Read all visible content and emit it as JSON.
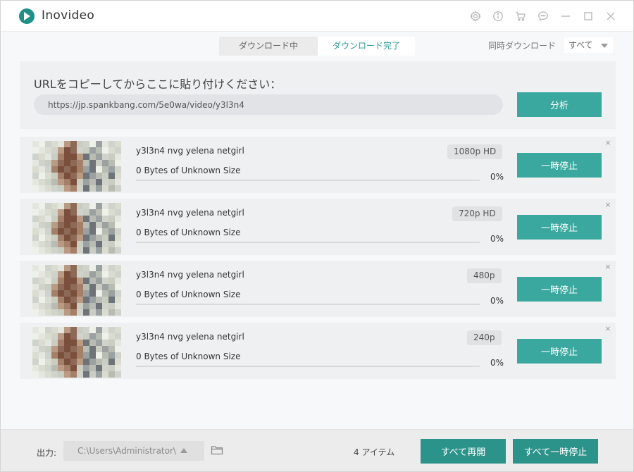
{
  "app": {
    "title": "Inovideo",
    "icons": [
      "settings-icon",
      "info-icon",
      "cart-icon",
      "feedback-icon",
      "minimize-icon",
      "maximize-icon",
      "close-icon"
    ]
  },
  "tabs": [
    {
      "label": "ダウンロード中",
      "active": false
    },
    {
      "label": "ダウンロード完了",
      "active": true
    }
  ],
  "concurrent": {
    "label": "同時ダウンロード",
    "value": "すべて"
  },
  "url_panel": {
    "heading": "URLをコピーしてからここに貼り付けください：",
    "url_value": "https://jp.spankbang.com/5e0wa/video/y3l3n4",
    "analyze_label": "分析"
  },
  "items": [
    {
      "title": "y3l3n4 nvg yelena netgirl",
      "quality": "1080p HD",
      "size": "0 Bytes of Unknown Size",
      "percent": "0%",
      "progress": 0,
      "pause_label": "一時停止",
      "close": "×"
    },
    {
      "title": "y3l3n4 nvg yelena netgirl",
      "quality": "720p HD",
      "size": "0 Bytes of Unknown Size",
      "percent": "0%",
      "progress": 0,
      "pause_label": "一時停止",
      "close": "×"
    },
    {
      "title": "y3l3n4 nvg yelena netgirl",
      "quality": "480p",
      "size": "0 Bytes of Unknown Size",
      "percent": "0%",
      "progress": 0,
      "pause_label": "一時停止",
      "close": "×"
    },
    {
      "title": "y3l3n4 nvg yelena netgirl",
      "quality": "240p",
      "size": "0 Bytes of Unknown Size",
      "percent": "0%",
      "progress": 0,
      "pause_label": "一時停止",
      "close": "×"
    }
  ],
  "bottom": {
    "output_label": "出力:",
    "output_path": "C:\\Users\\Administrator\\",
    "item_count": "4 アイテム",
    "resume_all_label": "すべて再開",
    "pause_all_label": "すべて一時停止"
  },
  "colors": {
    "accent": "#3aa89f",
    "accent_dark": "#2c938b",
    "panel_bg": "#eef0f2",
    "window_bg": "#f7f8fa"
  }
}
